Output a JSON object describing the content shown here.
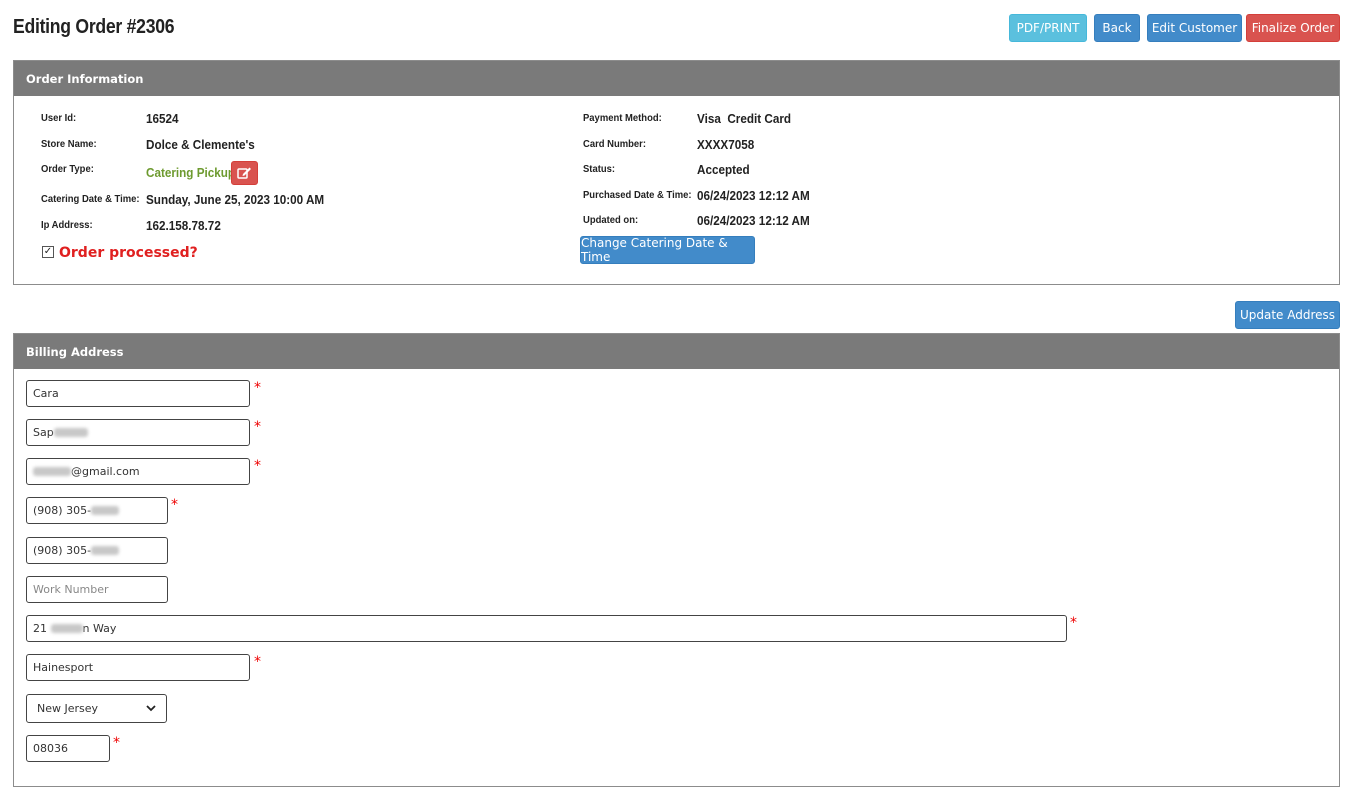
{
  "header": {
    "title": "Editing Order #2306",
    "buttons": {
      "pdf": "PDF/PRINT",
      "back": "Back",
      "edit_customer": "Edit Customer",
      "finalize": "Finalize Order"
    }
  },
  "order_info": {
    "heading": "Order Information",
    "left": [
      {
        "label": "User Id:",
        "value": "16524"
      },
      {
        "label": "Store Name:",
        "value": "Dolce & Clemente's"
      },
      {
        "label": "Order Type:",
        "value": "Catering Pickup"
      },
      {
        "label": "Catering Date & Time:",
        "value": "Sunday, June 25, 2023 10:00 AM"
      },
      {
        "label": "Ip Address:",
        "value": "162.158.78.72"
      }
    ],
    "right": [
      {
        "label": "Payment Method:",
        "value": "Visa  Credit Card"
      },
      {
        "label": "Card Number:",
        "value": "XXXX7058"
      },
      {
        "label": "Status:",
        "value": "Accepted"
      },
      {
        "label": "Purchased Date & Time:",
        "value": "06/24/2023 12:12 AM"
      },
      {
        "label": "Updated on:",
        "value": "06/24/2023 12:12 AM"
      }
    ],
    "order_processed_label": "Order processed?",
    "order_processed_checked": true,
    "change_date_button": "Change Catering Date & Time",
    "edit_icon": "edit-icon"
  },
  "update_address_button": "Update Address",
  "billing": {
    "heading": "Billing Address",
    "first_name": "Cara",
    "last_name_visible": "Sap",
    "email_visible_suffix": "@gmail.com",
    "phone_visible": "(908) 305-",
    "alt_phone_visible": "(908) 305-",
    "work_number_placeholder": "Work Number",
    "address_prefix": "21",
    "address_suffix": "n Way",
    "city": "Hainesport",
    "state": "New Jersey",
    "zip": "08036",
    "required_marker": "*"
  },
  "colors": {
    "heading_bg": "#7a7a7a",
    "info_btn": "#5bc0de",
    "primary_btn": "#428bca",
    "danger_btn": "#d9534f",
    "green_text": "#6d9a2f",
    "red_text": "#e02020"
  }
}
